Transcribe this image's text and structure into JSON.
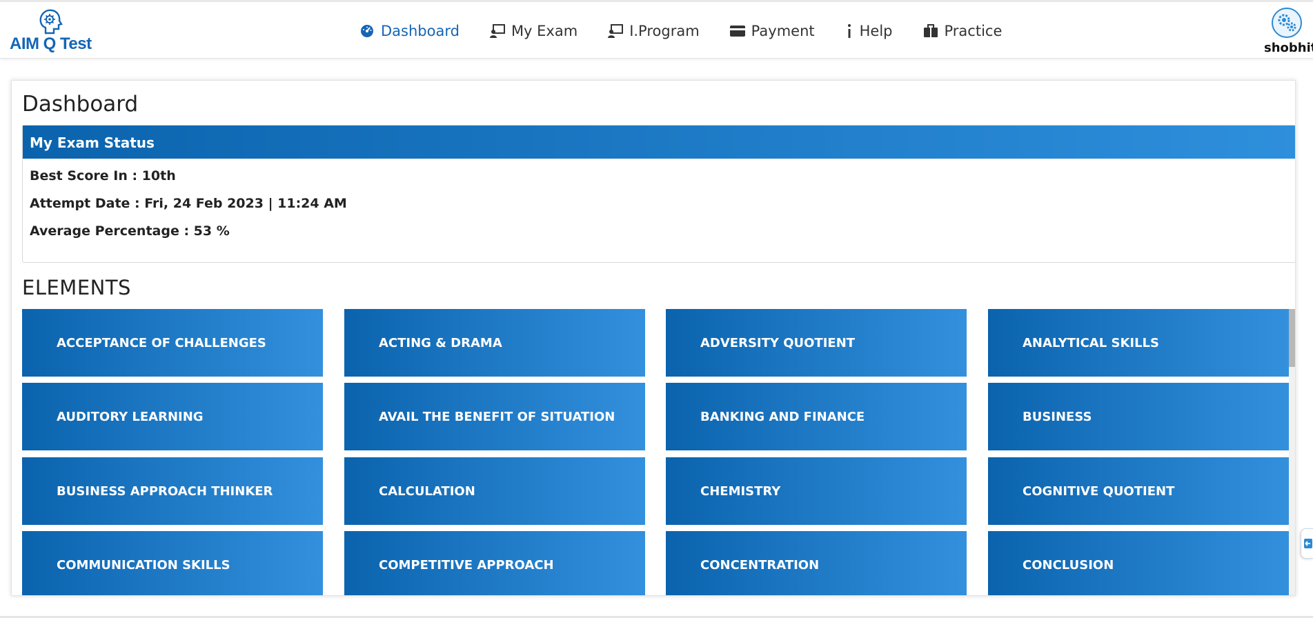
{
  "brand": {
    "name": "AIM Q Test"
  },
  "nav": {
    "items": [
      {
        "label": "Dashboard",
        "icon": "dashboard-gauge-icon",
        "active": true
      },
      {
        "label": "My Exam",
        "icon": "exam-monitor-icon",
        "active": false
      },
      {
        "label": "I.Program",
        "icon": "program-monitor-icon",
        "active": false
      },
      {
        "label": "Payment",
        "icon": "credit-card-icon",
        "active": false
      },
      {
        "label": "Help",
        "icon": "info-icon",
        "active": false
      },
      {
        "label": "Practice",
        "icon": "briefcase-icon",
        "active": false
      }
    ]
  },
  "user": {
    "name": "shobhit",
    "avatar_icon": "gears-avatar-icon"
  },
  "page": {
    "title": "Dashboard"
  },
  "exam_status": {
    "header": "My Exam Status",
    "best_score": "Best Score In : 10th",
    "attempt_date": "Attempt Date : Fri, 24 Feb 2023 | 11:24 AM",
    "average": "Average Percentage : 53 %"
  },
  "elements": {
    "title": "ELEMENTS",
    "items": [
      "ACCEPTANCE OF CHALLENGES",
      "ACTING & DRAMA",
      "ADVERSITY QUOTIENT",
      "ANALYTICAL SKILLS",
      "AUDITORY LEARNING",
      "AVAIL THE BENEFIT OF SITUATION",
      "BANKING AND FINANCE",
      "BUSINESS",
      "BUSINESS APPROACH THINKER",
      "CALCULATION",
      "CHEMISTRY",
      "COGNITIVE QUOTIENT",
      "COMMUNICATION SKILLS",
      "COMPETITIVE APPROACH",
      "CONCENTRATION",
      "CONCLUSION"
    ]
  },
  "colors": {
    "brand_blue": "#1565b5",
    "tile_start": "#0b63ad",
    "tile_end": "#3390dd"
  }
}
